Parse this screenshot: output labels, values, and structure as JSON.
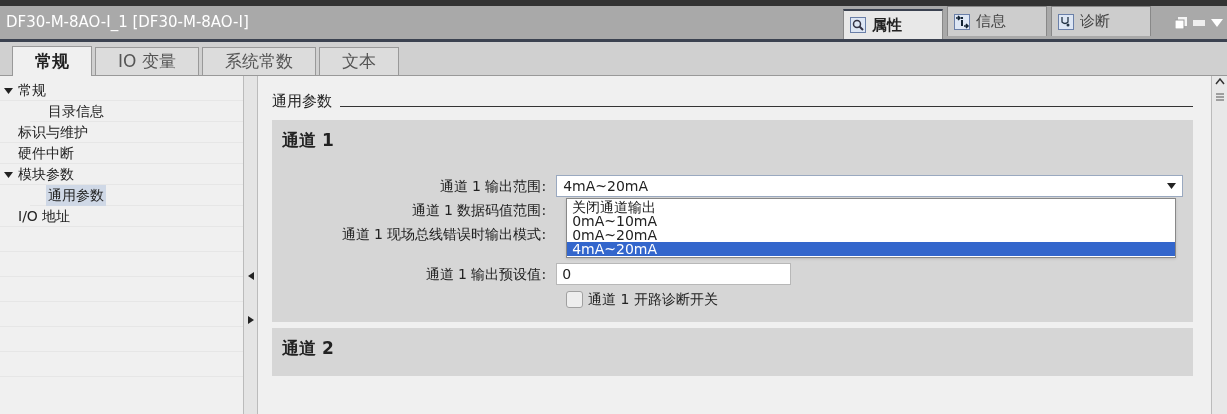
{
  "window": {
    "title": "DF30-M-8AO-I_1 [DF30-M-8AO-I]"
  },
  "inspector_tabs": [
    {
      "label": "属性",
      "kind": "properties",
      "selected": true
    },
    {
      "label": "信息",
      "kind": "info",
      "selected": false
    },
    {
      "label": "诊断",
      "kind": "diagnostics",
      "selected": false
    }
  ],
  "tabs": [
    {
      "label": "常规",
      "selected": true
    },
    {
      "label": "IO 变量",
      "selected": false
    },
    {
      "label": "系统常数",
      "selected": false
    },
    {
      "label": "文本",
      "selected": false
    }
  ],
  "tree": [
    {
      "label": "常规",
      "expanded": true,
      "selected": false,
      "children": [
        {
          "label": "目录信息",
          "selected": false
        }
      ]
    },
    {
      "label": "标识与维护",
      "selected": false
    },
    {
      "label": "硬件中断",
      "selected": false
    },
    {
      "label": "模块参数",
      "expanded": true,
      "selected": false,
      "children": [
        {
          "label": "通用参数",
          "selected": true
        }
      ]
    },
    {
      "label": "I/O 地址",
      "selected": false
    }
  ],
  "section_title": "通用参数",
  "channels": [
    {
      "title": "通道 1",
      "fields": [
        {
          "kind": "dropdown",
          "label": "通道 1 输出范围:",
          "value": "4mA~20mA",
          "open": true,
          "options": [
            {
              "label": "关闭通道输出",
              "selected": false
            },
            {
              "label": "0mA~10mA",
              "selected": false
            },
            {
              "label": "0mA~20mA",
              "selected": false
            },
            {
              "label": "4mA~20mA",
              "selected": true
            }
          ]
        },
        {
          "kind": "covered",
          "label": "通道 1 数据码值范围:"
        },
        {
          "kind": "covered",
          "label": "通道 1 现场总线错误时输出模式:"
        },
        {
          "kind": "input",
          "label": "通道 1 输出预设值:",
          "value": "0"
        },
        {
          "kind": "checkbox",
          "label": "通道 1 开路诊断开关",
          "checked": false
        }
      ]
    },
    {
      "title": "通道 2"
    }
  ]
}
